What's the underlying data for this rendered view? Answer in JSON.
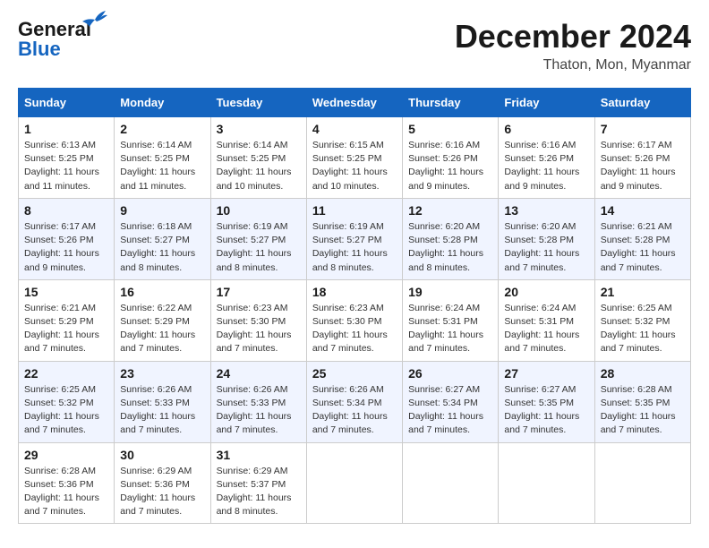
{
  "header": {
    "logo_line1": "General",
    "logo_line2": "Blue",
    "month": "December 2024",
    "location": "Thaton, Mon, Myanmar"
  },
  "weekdays": [
    "Sunday",
    "Monday",
    "Tuesday",
    "Wednesday",
    "Thursday",
    "Friday",
    "Saturday"
  ],
  "weeks": [
    [
      {
        "day": "1",
        "sunrise": "6:13 AM",
        "sunset": "5:25 PM",
        "daylight": "11 hours and 11 minutes."
      },
      {
        "day": "2",
        "sunrise": "6:14 AM",
        "sunset": "5:25 PM",
        "daylight": "11 hours and 11 minutes."
      },
      {
        "day": "3",
        "sunrise": "6:14 AM",
        "sunset": "5:25 PM",
        "daylight": "11 hours and 10 minutes."
      },
      {
        "day": "4",
        "sunrise": "6:15 AM",
        "sunset": "5:25 PM",
        "daylight": "11 hours and 10 minutes."
      },
      {
        "day": "5",
        "sunrise": "6:16 AM",
        "sunset": "5:26 PM",
        "daylight": "11 hours and 9 minutes."
      },
      {
        "day": "6",
        "sunrise": "6:16 AM",
        "sunset": "5:26 PM",
        "daylight": "11 hours and 9 minutes."
      },
      {
        "day": "7",
        "sunrise": "6:17 AM",
        "sunset": "5:26 PM",
        "daylight": "11 hours and 9 minutes."
      }
    ],
    [
      {
        "day": "8",
        "sunrise": "6:17 AM",
        "sunset": "5:26 PM",
        "daylight": "11 hours and 9 minutes."
      },
      {
        "day": "9",
        "sunrise": "6:18 AM",
        "sunset": "5:27 PM",
        "daylight": "11 hours and 8 minutes."
      },
      {
        "day": "10",
        "sunrise": "6:19 AM",
        "sunset": "5:27 PM",
        "daylight": "11 hours and 8 minutes."
      },
      {
        "day": "11",
        "sunrise": "6:19 AM",
        "sunset": "5:27 PM",
        "daylight": "11 hours and 8 minutes."
      },
      {
        "day": "12",
        "sunrise": "6:20 AM",
        "sunset": "5:28 PM",
        "daylight": "11 hours and 8 minutes."
      },
      {
        "day": "13",
        "sunrise": "6:20 AM",
        "sunset": "5:28 PM",
        "daylight": "11 hours and 7 minutes."
      },
      {
        "day": "14",
        "sunrise": "6:21 AM",
        "sunset": "5:28 PM",
        "daylight": "11 hours and 7 minutes."
      }
    ],
    [
      {
        "day": "15",
        "sunrise": "6:21 AM",
        "sunset": "5:29 PM",
        "daylight": "11 hours and 7 minutes."
      },
      {
        "day": "16",
        "sunrise": "6:22 AM",
        "sunset": "5:29 PM",
        "daylight": "11 hours and 7 minutes."
      },
      {
        "day": "17",
        "sunrise": "6:23 AM",
        "sunset": "5:30 PM",
        "daylight": "11 hours and 7 minutes."
      },
      {
        "day": "18",
        "sunrise": "6:23 AM",
        "sunset": "5:30 PM",
        "daylight": "11 hours and 7 minutes."
      },
      {
        "day": "19",
        "sunrise": "6:24 AM",
        "sunset": "5:31 PM",
        "daylight": "11 hours and 7 minutes."
      },
      {
        "day": "20",
        "sunrise": "6:24 AM",
        "sunset": "5:31 PM",
        "daylight": "11 hours and 7 minutes."
      },
      {
        "day": "21",
        "sunrise": "6:25 AM",
        "sunset": "5:32 PM",
        "daylight": "11 hours and 7 minutes."
      }
    ],
    [
      {
        "day": "22",
        "sunrise": "6:25 AM",
        "sunset": "5:32 PM",
        "daylight": "11 hours and 7 minutes."
      },
      {
        "day": "23",
        "sunrise": "6:26 AM",
        "sunset": "5:33 PM",
        "daylight": "11 hours and 7 minutes."
      },
      {
        "day": "24",
        "sunrise": "6:26 AM",
        "sunset": "5:33 PM",
        "daylight": "11 hours and 7 minutes."
      },
      {
        "day": "25",
        "sunrise": "6:26 AM",
        "sunset": "5:34 PM",
        "daylight": "11 hours and 7 minutes."
      },
      {
        "day": "26",
        "sunrise": "6:27 AM",
        "sunset": "5:34 PM",
        "daylight": "11 hours and 7 minutes."
      },
      {
        "day": "27",
        "sunrise": "6:27 AM",
        "sunset": "5:35 PM",
        "daylight": "11 hours and 7 minutes."
      },
      {
        "day": "28",
        "sunrise": "6:28 AM",
        "sunset": "5:35 PM",
        "daylight": "11 hours and 7 minutes."
      }
    ],
    [
      {
        "day": "29",
        "sunrise": "6:28 AM",
        "sunset": "5:36 PM",
        "daylight": "11 hours and 7 minutes."
      },
      {
        "day": "30",
        "sunrise": "6:29 AM",
        "sunset": "5:36 PM",
        "daylight": "11 hours and 7 minutes."
      },
      {
        "day": "31",
        "sunrise": "6:29 AM",
        "sunset": "5:37 PM",
        "daylight": "11 hours and 8 minutes."
      },
      null,
      null,
      null,
      null
    ]
  ]
}
